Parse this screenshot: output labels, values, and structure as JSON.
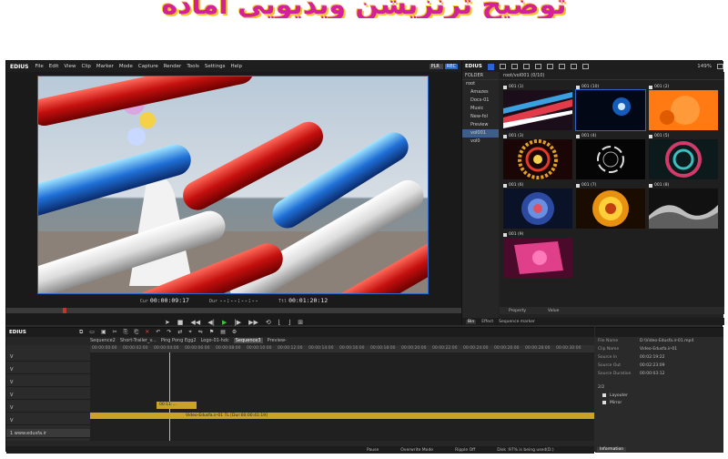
{
  "banner": {
    "text": "توضیح ترنزیشن ویدیویی آماده"
  },
  "menubar": {
    "logo": "EDIUS",
    "items": [
      "File",
      "Edit",
      "View",
      "Clip",
      "Marker",
      "Mode",
      "Capture",
      "Render",
      "Tools",
      "Settings",
      "Help"
    ],
    "plr": "PLR",
    "rec": "REC"
  },
  "monitor": {
    "cur_label": "Cur",
    "cur": "00:00:09:17",
    "dur_label": "Dur",
    "dur": "--:--:--:--",
    "ttl_label": "Ttl",
    "ttl": "00:01:20:12"
  },
  "bin": {
    "logo": "EDIUS",
    "zoom": "149%",
    "folder_header": "FOLDER",
    "path": "root/vol001 (0/10)",
    "folders": [
      "root",
      "Amazes",
      "Docs-01",
      "Music",
      "New-fol",
      "Preview",
      "vol001",
      "vol0"
    ],
    "clips": [
      "001 (1)",
      "001 (10)",
      "001 (2)",
      "001 (3)",
      "001 (4)",
      "001 (5)",
      "001 (6)",
      "001 (7)",
      "001 (8)",
      "001 (9)"
    ],
    "prop_col1": "Property",
    "prop_col2": "Value",
    "tabs": [
      "Bin",
      "Effect",
      "Sequence marker"
    ]
  },
  "timeline": {
    "logo": "EDIUS",
    "seq_tabs": [
      "Sequence2",
      "Short-Trailer_v...",
      "Ping Pong Egg2",
      "Logo-01-hdc",
      "Sequence3",
      "Preview-"
    ],
    "ruler": [
      "00:00:00:00",
      "00:00:02:00",
      "00:00:04:00",
      "00:00:06:00",
      "00:00:08:00",
      "00:00:10:00",
      "00:00:12:00",
      "00:00:14:00",
      "00:00:16:00",
      "00:00:18:00",
      "00:00:20:00",
      "00:00:22:00",
      "00:00:24:00",
      "00:00:26:00",
      "00:00:28:00",
      "00:00:30:00"
    ],
    "tracks": [
      "V",
      "V",
      "V",
      "V",
      "V",
      "V",
      "1 www.edusfa.ir"
    ],
    "small_clip": "00:11:...",
    "main_clip": "Video-Edusfa.ir-01  TL [Dur:00:00:41:19]",
    "status": [
      "Pause",
      "Overwrite Mode",
      "Ripple Off",
      "Disk :97% is being used(D:)"
    ]
  },
  "info": {
    "rows": [
      {
        "k": "File Name",
        "v": "D:\\Video-Edusfa.ir-01.mp4"
      },
      {
        "k": "Clip Name",
        "v": "Video-Edusfa.ir-01"
      },
      {
        "k": "Source In",
        "v": "00:02:19:22"
      },
      {
        "k": "Source Out",
        "v": "00:02:23:09"
      },
      {
        "k": "Source Duration",
        "v": "00:00:03:12"
      }
    ],
    "count": "2/2",
    "effects": [
      "Layouter",
      "Mirror"
    ],
    "tab": "Information"
  },
  "colors": {
    "accent": "#2a67c9",
    "clip_yellow": "#c9a227",
    "banner": "#d4219a"
  }
}
